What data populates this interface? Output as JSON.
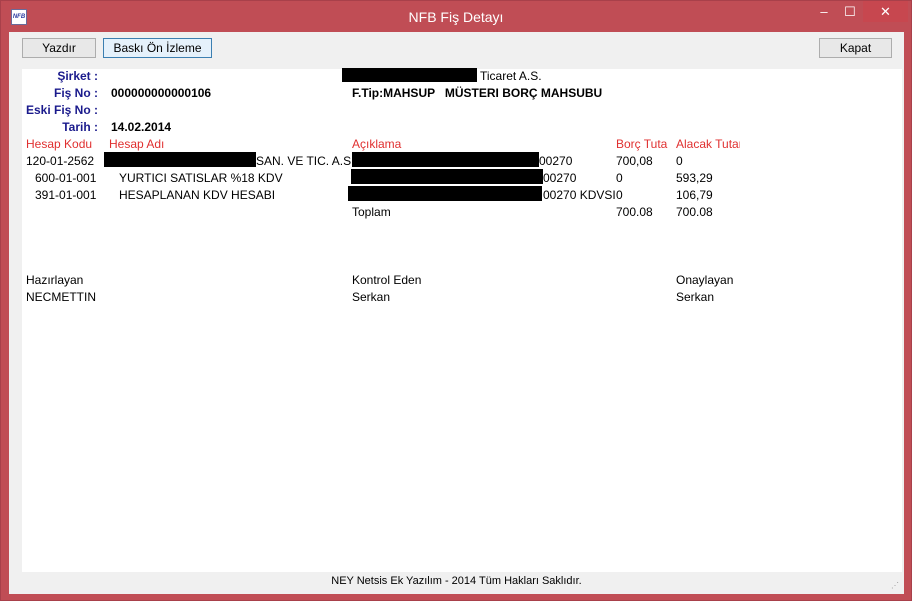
{
  "window": {
    "title": "NFB Fiş Detayı",
    "app_icon_text": "NFB",
    "min_glyph": "–",
    "max_glyph": "☐",
    "close_glyph": "✕"
  },
  "toolbar": {
    "print_label": "Yazdır",
    "preview_label": "Baskı Ön İzleme",
    "close_label": "Kapat"
  },
  "header": {
    "company_label": "Şirket :",
    "company_value": "Ticaret A.S.",
    "voucher_no_label": "Fiş No :",
    "voucher_no_value": "000000000000106",
    "voucher_type": "F.Tip:MAHSUP   MÜSTERI BORÇ MAHSUBU",
    "old_voucher_label": "Eski Fiş No :",
    "date_label": "Tarih :",
    "date_value": "14.02.2014"
  },
  "table": {
    "columns": {
      "code": "Hesap Kodu",
      "name": "Hesap Adı",
      "desc": "Açıklama",
      "debit": "Borç Tutarı",
      "credit": "Alacak Tutarı"
    },
    "rows": [
      {
        "code": "120-01-2562",
        "name": "SAN. VE TIC. A.S.",
        "desc": "00270",
        "debit": "700,08",
        "credit": "0"
      },
      {
        "code": "600-01-001",
        "name": "YURTICI SATISLAR %18 KDV",
        "desc": "00270",
        "debit": "0",
        "credit": "593,29"
      },
      {
        "code": "391-01-001",
        "name": "HESAPLANAN KDV HESABI",
        "desc": "00270 KDVSI",
        "debit": "0",
        "credit": "106,79"
      }
    ],
    "total": {
      "label": "Toplam",
      "debit": "700.08",
      "credit": "700.08"
    }
  },
  "signatures": {
    "prepared_label": "Hazırlayan",
    "prepared_value": "NECMETTIN",
    "control_label": "Kontrol Eden",
    "control_value": "Serkan",
    "approve_label": "Onaylayan",
    "approve_value": "Serkan"
  },
  "footer": {
    "copyright": "NEY Netsis Ek Yazılım - 2014 Tüm Hakları Saklıdır."
  }
}
